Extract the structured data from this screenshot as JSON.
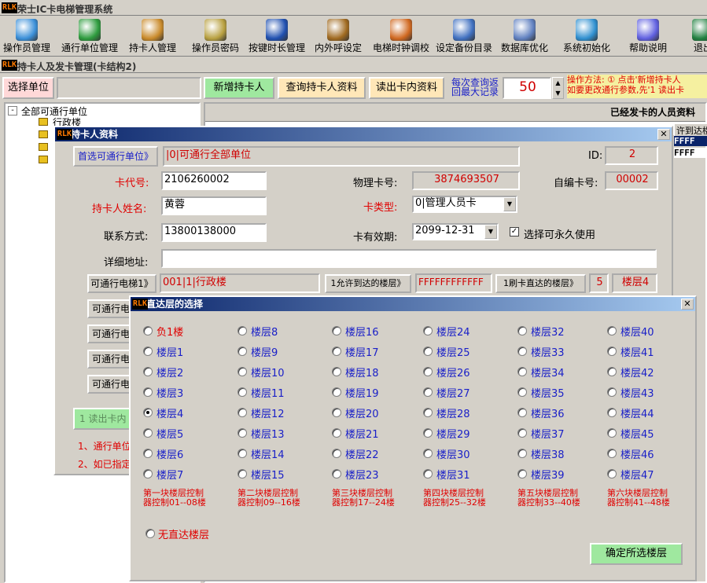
{
  "app": {
    "logo": "RLK",
    "title": "荣士IC卡电梯管理系统"
  },
  "toolbar": [
    {
      "label": "操作员管理",
      "color": "#3a8fd8"
    },
    {
      "label": "通行单位管理",
      "color": "#2e9c3e"
    },
    {
      "label": "持卡人管理",
      "color": "#c98a2a"
    },
    {
      "label": "操作员密码",
      "color": "#b8a040"
    },
    {
      "label": "按键时长管理",
      "color": "#2050b0"
    },
    {
      "label": "内外呼设定",
      "color": "#a06a20"
    },
    {
      "label": "电梯时钟调校",
      "color": "#d06820"
    },
    {
      "label": "设定备份目录",
      "color": "#4070c0"
    },
    {
      "label": "数据库优化",
      "color": "#6080c0"
    },
    {
      "label": "系统初始化",
      "color": "#3090d0"
    },
    {
      "label": "帮助说明",
      "color": "#6060e0"
    },
    {
      "label": "退出",
      "color": "#208040"
    }
  ],
  "sub": {
    "title": "持卡人及发卡管理(卡结构2)"
  },
  "top": {
    "select_unit": "选择单位",
    "add_holder": "新增持卡人",
    "query_holder": "查询持卡人资料",
    "read_card": "读出卡内资料",
    "max_records_label1": "每次查询返",
    "max_records_label2": "回最大记录",
    "max_records": "50",
    "hint1": "操作方法: ① 点击'新增持卡人",
    "hint2": "如要更改通行参数,先'1 读出卡"
  },
  "tree": {
    "root": "全部可通行单位",
    "child1": "行政楼"
  },
  "issued": {
    "title": "已经发卡的人员资料",
    "col": "许到达楼",
    "row1": "FFFF",
    "row2": "FFFF"
  },
  "holder": {
    "title": "持卡人资料",
    "select_unit_btn": "首选可通行单位》",
    "unit_value": "|0|可通行全部单位",
    "id_label": "ID:",
    "id_value": "2",
    "card_no_label": "卡代号:",
    "card_no": "2106260002",
    "phys_label": "物理卡号:",
    "phys_value": "3874693507",
    "self_label": "自编卡号:",
    "self_value": "00002",
    "name_label": "持卡人姓名:",
    "name": "黄蓉",
    "type_label": "卡类型:",
    "type_value": "0|管理人员卡",
    "phone_label": "联系方式:",
    "phone": "13800138000",
    "valid_label": "卡有效期:",
    "valid_value": "2099-12-31",
    "perm_label": "选择可永久使用",
    "addr_label": "详细地址:",
    "addr": "",
    "elev1_btn": "可通行电梯1》",
    "elev1_value": "001|1|行政楼",
    "allow_btn": "1允许到达的楼层》",
    "allow_value": "FFFFFFFFFFFF",
    "direct_btn": "1刷卡直达的楼层》",
    "direct_num": "5",
    "direct_floor": "楼层4",
    "elev_btn_short": "可通行电",
    "read_btn": "1 读出卡内",
    "note1": "1、通行单位",
    "note2": "2、如已指定"
  },
  "direct": {
    "title": "直达层的选择",
    "floors": [
      "负1楼",
      "楼层1",
      "楼层2",
      "楼层3",
      "楼层4",
      "楼层5",
      "楼层6",
      "楼层7",
      "楼层8",
      "楼层9",
      "楼层10",
      "楼层11",
      "楼层12",
      "楼层13",
      "楼层14",
      "楼层15",
      "楼层16",
      "楼层17",
      "楼层18",
      "楼层19",
      "楼层20",
      "楼层21",
      "楼层22",
      "楼层23",
      "楼层24",
      "楼层25",
      "楼层26",
      "楼层27",
      "楼层28",
      "楼层29",
      "楼层30",
      "楼层31",
      "楼层32",
      "楼层33",
      "楼层34",
      "楼层35",
      "楼层36",
      "楼层37",
      "楼层38",
      "楼层39",
      "楼层40",
      "楼层41",
      "楼层42",
      "楼层43",
      "楼层44",
      "楼层45",
      "楼层46",
      "楼层47"
    ],
    "selected_index": 4,
    "groups": [
      [
        "第一块楼层控制",
        "器控制01--08楼"
      ],
      [
        "第二块楼层控制",
        "器控制09--16楼"
      ],
      [
        "第三块楼层控制",
        "器控制17--24楼"
      ],
      [
        "第四块楼层控制",
        "器控制25--32楼"
      ],
      [
        "第五块楼层控制",
        "器控制33--40楼"
      ],
      [
        "第六块楼层控制",
        "器控制41--48楼"
      ]
    ],
    "none_label": "无直达楼层",
    "confirm": "确定所选楼层"
  }
}
